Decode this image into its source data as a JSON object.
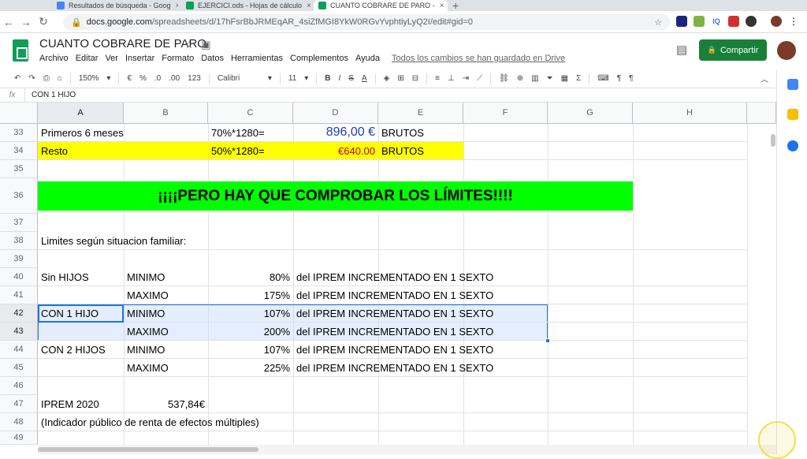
{
  "browser": {
    "tabs": [
      {
        "title": "Resultados de búsqueda - Goog",
        "color": "#4285f4"
      },
      {
        "title": "EJERCICI.ods - Hojas de cálculo",
        "color": "#0f9d58"
      },
      {
        "title": "CUANTO COBRARE DE PARO - ",
        "color": "#0f9d58"
      }
    ],
    "new_tab": "+",
    "url_host": "docs.google.com",
    "url_path": "/spreadsheets/d/17hFsrBbJRMEqAR_4siZfMGI8YkW0RGvYvphtiyLyQ2I/edit#gid=0",
    "ext_label": "IQ"
  },
  "doc": {
    "title": "CUANTO COBRARE DE PARO",
    "menu": [
      "Archivo",
      "Editar",
      "Ver",
      "Insertar",
      "Formato",
      "Datos",
      "Herramientas",
      "Complementos",
      "Ayuda"
    ],
    "saved_status": "Todos los cambios se han guardado en Drive",
    "share_label": "Compartir"
  },
  "toolbar": {
    "zoom": "150%",
    "currency": "€",
    "percent": "%",
    "dec_less": ".0",
    "dec_more": ".00",
    "format_num": "123",
    "font": "Calibri",
    "size": "11",
    "bold": "B",
    "italic": "I",
    "strike": "S",
    "textcolor": "A"
  },
  "formula": {
    "fx": "fx",
    "value": "CON 1 HIJO"
  },
  "columns": [
    "A",
    "B",
    "C",
    "D",
    "E",
    "F",
    "G",
    "H"
  ],
  "rows": [
    {
      "n": "33",
      "A": "Primeros 6 meses",
      "C": "70%*1280=",
      "D": "896,00 €",
      "E": "BRUTOS"
    },
    {
      "n": "34",
      "A": "Resto",
      "C": "50%*1280=",
      "D": "€640.00",
      "E": "BRUTOS"
    },
    {
      "n": "35"
    },
    {
      "n": "36",
      "banner": "¡¡¡¡PERO HAY QUE COMPROBAR LOS LÍMITES!!!!"
    },
    {
      "n": "37"
    },
    {
      "n": "38",
      "A": "Limites según situacion familiar:"
    },
    {
      "n": "39"
    },
    {
      "n": "40",
      "A": "Sin HIJOS",
      "B": "MINIMO",
      "C": "80%",
      "D": "del IPREM INCREMENTADO EN 1 SEXTO"
    },
    {
      "n": "41",
      "B": "MAXIMO",
      "C": "175%",
      "D": "del IPREM INCREMENTADO EN 1 SEXTO"
    },
    {
      "n": "42",
      "A": "CON 1 HIJO",
      "B": "MINIMO",
      "C": "107%",
      "D": "del IPREM INCREMENTADO EN 1 SEXTO"
    },
    {
      "n": "43",
      "B": "MAXIMO",
      "C": "200%",
      "D": "del IPREM INCREMENTADO EN 1 SEXTO"
    },
    {
      "n": "44",
      "A": "CON 2 HIJOS",
      "B": "MINIMO",
      "C": "107%",
      "D": "del IPREM INCREMENTADO EN 1 SEXTO"
    },
    {
      "n": "45",
      "B": "MAXIMO",
      "C": "225%",
      "D": "del IPREM INCREMENTADO EN 1 SEXTO"
    },
    {
      "n": "46"
    },
    {
      "n": "47",
      "A": "IPREM 2020",
      "B": "537,84€"
    },
    {
      "n": "48",
      "A": "(Indicador público de renta de efectos múltiples)"
    },
    {
      "n": "49"
    }
  ],
  "colors": {
    "banner": "#00ff00",
    "highlight": "#ffff00",
    "blue_value": "#1a3fb5",
    "red_value": "#c00000",
    "selection": "#1a73e8"
  }
}
